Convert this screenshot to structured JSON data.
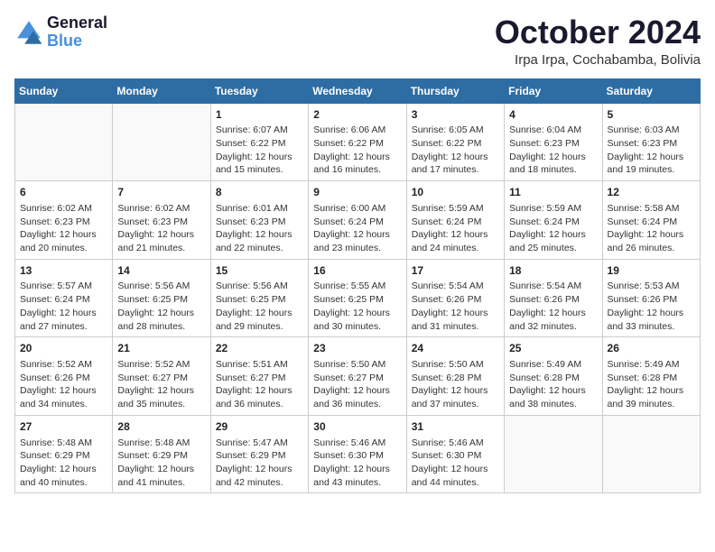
{
  "header": {
    "logo_general": "General",
    "logo_blue": "Blue",
    "month": "October 2024",
    "location": "Irpa Irpa, Cochabamba, Bolivia"
  },
  "days_of_week": [
    "Sunday",
    "Monday",
    "Tuesday",
    "Wednesday",
    "Thursday",
    "Friday",
    "Saturday"
  ],
  "weeks": [
    [
      {
        "num": "",
        "info": ""
      },
      {
        "num": "",
        "info": ""
      },
      {
        "num": "1",
        "info": "Sunrise: 6:07 AM\nSunset: 6:22 PM\nDaylight: 12 hours and 15 minutes."
      },
      {
        "num": "2",
        "info": "Sunrise: 6:06 AM\nSunset: 6:22 PM\nDaylight: 12 hours and 16 minutes."
      },
      {
        "num": "3",
        "info": "Sunrise: 6:05 AM\nSunset: 6:22 PM\nDaylight: 12 hours and 17 minutes."
      },
      {
        "num": "4",
        "info": "Sunrise: 6:04 AM\nSunset: 6:23 PM\nDaylight: 12 hours and 18 minutes."
      },
      {
        "num": "5",
        "info": "Sunrise: 6:03 AM\nSunset: 6:23 PM\nDaylight: 12 hours and 19 minutes."
      }
    ],
    [
      {
        "num": "6",
        "info": "Sunrise: 6:02 AM\nSunset: 6:23 PM\nDaylight: 12 hours and 20 minutes."
      },
      {
        "num": "7",
        "info": "Sunrise: 6:02 AM\nSunset: 6:23 PM\nDaylight: 12 hours and 21 minutes."
      },
      {
        "num": "8",
        "info": "Sunrise: 6:01 AM\nSunset: 6:23 PM\nDaylight: 12 hours and 22 minutes."
      },
      {
        "num": "9",
        "info": "Sunrise: 6:00 AM\nSunset: 6:24 PM\nDaylight: 12 hours and 23 minutes."
      },
      {
        "num": "10",
        "info": "Sunrise: 5:59 AM\nSunset: 6:24 PM\nDaylight: 12 hours and 24 minutes."
      },
      {
        "num": "11",
        "info": "Sunrise: 5:59 AM\nSunset: 6:24 PM\nDaylight: 12 hours and 25 minutes."
      },
      {
        "num": "12",
        "info": "Sunrise: 5:58 AM\nSunset: 6:24 PM\nDaylight: 12 hours and 26 minutes."
      }
    ],
    [
      {
        "num": "13",
        "info": "Sunrise: 5:57 AM\nSunset: 6:24 PM\nDaylight: 12 hours and 27 minutes."
      },
      {
        "num": "14",
        "info": "Sunrise: 5:56 AM\nSunset: 6:25 PM\nDaylight: 12 hours and 28 minutes."
      },
      {
        "num": "15",
        "info": "Sunrise: 5:56 AM\nSunset: 6:25 PM\nDaylight: 12 hours and 29 minutes."
      },
      {
        "num": "16",
        "info": "Sunrise: 5:55 AM\nSunset: 6:25 PM\nDaylight: 12 hours and 30 minutes."
      },
      {
        "num": "17",
        "info": "Sunrise: 5:54 AM\nSunset: 6:26 PM\nDaylight: 12 hours and 31 minutes."
      },
      {
        "num": "18",
        "info": "Sunrise: 5:54 AM\nSunset: 6:26 PM\nDaylight: 12 hours and 32 minutes."
      },
      {
        "num": "19",
        "info": "Sunrise: 5:53 AM\nSunset: 6:26 PM\nDaylight: 12 hours and 33 minutes."
      }
    ],
    [
      {
        "num": "20",
        "info": "Sunrise: 5:52 AM\nSunset: 6:26 PM\nDaylight: 12 hours and 34 minutes."
      },
      {
        "num": "21",
        "info": "Sunrise: 5:52 AM\nSunset: 6:27 PM\nDaylight: 12 hours and 35 minutes."
      },
      {
        "num": "22",
        "info": "Sunrise: 5:51 AM\nSunset: 6:27 PM\nDaylight: 12 hours and 36 minutes."
      },
      {
        "num": "23",
        "info": "Sunrise: 5:50 AM\nSunset: 6:27 PM\nDaylight: 12 hours and 36 minutes."
      },
      {
        "num": "24",
        "info": "Sunrise: 5:50 AM\nSunset: 6:28 PM\nDaylight: 12 hours and 37 minutes."
      },
      {
        "num": "25",
        "info": "Sunrise: 5:49 AM\nSunset: 6:28 PM\nDaylight: 12 hours and 38 minutes."
      },
      {
        "num": "26",
        "info": "Sunrise: 5:49 AM\nSunset: 6:28 PM\nDaylight: 12 hours and 39 minutes."
      }
    ],
    [
      {
        "num": "27",
        "info": "Sunrise: 5:48 AM\nSunset: 6:29 PM\nDaylight: 12 hours and 40 minutes."
      },
      {
        "num": "28",
        "info": "Sunrise: 5:48 AM\nSunset: 6:29 PM\nDaylight: 12 hours and 41 minutes."
      },
      {
        "num": "29",
        "info": "Sunrise: 5:47 AM\nSunset: 6:29 PM\nDaylight: 12 hours and 42 minutes."
      },
      {
        "num": "30",
        "info": "Sunrise: 5:46 AM\nSunset: 6:30 PM\nDaylight: 12 hours and 43 minutes."
      },
      {
        "num": "31",
        "info": "Sunrise: 5:46 AM\nSunset: 6:30 PM\nDaylight: 12 hours and 44 minutes."
      },
      {
        "num": "",
        "info": ""
      },
      {
        "num": "",
        "info": ""
      }
    ]
  ]
}
